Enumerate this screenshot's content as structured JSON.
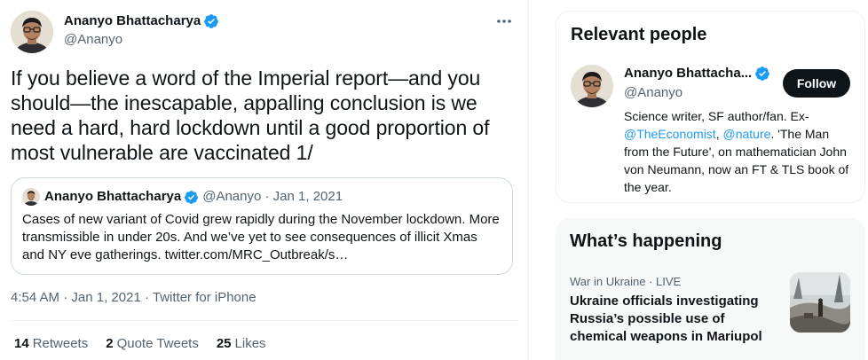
{
  "tweet": {
    "author_name": "Ananyo Bhattacharya",
    "author_handle": "@Ananyo",
    "more_icon": "more-horizontal-icon",
    "text": "If you believe a word of the Imperial report—and you should—the inescapable, appalling conclusion is we need a hard, hard lockdown until a good proportion of most vulnerable are vaccinated 1/",
    "timestamp_time": "4:54 AM",
    "timestamp_sep1": " · ",
    "timestamp_date": "Jan 1, 2021",
    "timestamp_sep2": " · ",
    "timestamp_source": "Twitter for iPhone"
  },
  "quote": {
    "author_name": "Ananyo Bhattacharya",
    "author_handle": "@Ananyo",
    "separator": " · ",
    "date": "Jan 1, 2021",
    "text": "Cases of new variant of Covid grew rapidly during the November lockdown. More transmissible in under 20s. And we’ve yet to see consequences of illicit Xmas and NY eve gatherings. twitter.com/MRC_Outbreak/s…"
  },
  "stats": [
    {
      "count": "14",
      "label": "Retweets"
    },
    {
      "count": "2",
      "label": "Quote Tweets"
    },
    {
      "count": "25",
      "label": "Likes"
    }
  ],
  "relevant_people": {
    "title": "Relevant people",
    "name": "Ananyo Bhattacha...",
    "handle": "@Ananyo",
    "follow_label": "Follow",
    "bio_1": "Science writer, SF author/fan. Ex-",
    "bio_link1": "@TheEconomist",
    "bio_2": ", ",
    "bio_link2": "@nature",
    "bio_3": ". 'The Man from the Future', on mathematician John von Neumann, now an FT & TLS book of the year."
  },
  "whats_happening": {
    "title": "What’s happening",
    "trend_category": "War in Ukraine",
    "trend_sep": " · ",
    "trend_status": "LIVE",
    "trend_title": "Ukraine officials investigating Russia’s possible use of chemical weapons in Mariupol"
  },
  "colors": {
    "accent": "#1d9bf0",
    "text": "#0f1419",
    "secondary": "#536471",
    "border": "#cfd9de",
    "follow_bg": "#0f1419"
  }
}
